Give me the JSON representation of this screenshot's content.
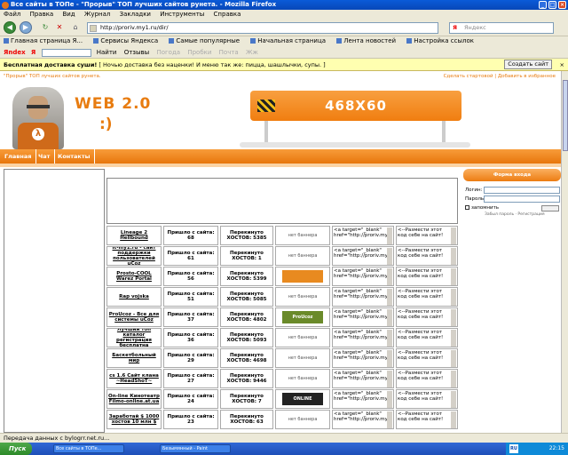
{
  "window": {
    "title": "Все сайты в ТОПе - \"Прорыв\" ТОП лучших сайтов рунета. - Mozilla Firefox"
  },
  "menu": [
    "Файл",
    "Правка",
    "Вид",
    "Журнал",
    "Закладки",
    "Инструменты",
    "Справка"
  ],
  "nav": {
    "url": "http://proriv.my1.ru/dir/",
    "search_placeholder": "Яндекс",
    "search_brand": "Я"
  },
  "bookmarks": [
    "Главная страница Я...",
    "Сервисы Яндекса",
    "Самые популярные",
    "Начальная страница",
    "Лента новостей",
    "Настройка ссылок"
  ],
  "yandex_bar": {
    "logo": "Яndex",
    "brand": "Я",
    "find": "Найти",
    "reviews": "Отзывы",
    "items": [
      "Погода",
      "Пробки",
      "Почта",
      "Жж"
    ]
  },
  "notification": {
    "bold": "Бесплатная доставка суши!",
    "text": "[ Ночью доставка без наценки! И меню так же: пицца, шашлычки, супы. ]",
    "button": "Создать сайт"
  },
  "site": {
    "top_left": "\"Прорыв\" ТОП лучших сайтов рунета.",
    "top_right": "Сделать стартовой | Добавить в избранное",
    "logo": "WEB 2.0",
    "smile": ":)",
    "banner": "468X60",
    "menu": [
      "Главная",
      "Чат",
      "Контакты"
    ]
  },
  "login": {
    "header": "Форма входа",
    "login_label": "Логин:",
    "password_label": "Пароль:",
    "remember": "запомнить",
    "small": "Забыл пароль · Регистрация"
  },
  "rows": [
    {
      "name": "Lineage 2 Hellbound",
      "visits": "Пришло с сайта: 68",
      "out": "Перекинуто ХОСТОВ: 5385",
      "button": "нет баннера",
      "code": "<a target=\"_blank\" href=\"http://proriv.my1",
      "place": "<--Размести этот код себе на сайт!"
    },
    {
      "name": "It-my1.ru - сайт поддержки пользователей uCoz",
      "visits": "Пришло с сайта: 61",
      "out": "Перекинуто ХОСТОВ: 1",
      "button": "нет баннера",
      "code": "<a target=\"_blank\" href=\"http://proriv.my1",
      "place": "<--Размести этот код себе на сайт!"
    },
    {
      "name": "Prosto-COOL Warez Portal",
      "visits": "Пришло с сайта: 56",
      "out": "Перекинуто ХОСТОВ: 5399",
      "button": "",
      "code": "<a target=\"_blank\" href=\"http://proriv.my1",
      "place": "<--Размести этот код себе на сайт!"
    },
    {
      "name": "Rap vojska",
      "visits": "Пришло с сайта: 51",
      "out": "Перекинуто ХОСТОВ: 5085",
      "button": "нет баннера",
      "code": "<a target=\"_blank\" href=\"http://proriv.my1",
      "place": "<--Размести этот код себе на сайт!"
    },
    {
      "name": "ProUcoz - Все для системы uCoz",
      "visits": "Пришло с сайта: 37",
      "out": "Перекинуто ХОСТОВ: 4802",
      "button": "ProUcoz",
      "code": "<a target=\"_blank\" href=\"http://proriv.my1",
      "place": "<--Размести этот код себе на сайт!"
    },
    {
      "name": "Лучший топ каталог регистрация бесплатна",
      "visits": "Пришло с сайта: 36",
      "out": "Перекинуто ХОСТОВ: 5093",
      "button": "нет баннера",
      "code": "<a target=\"_blank\" href=\"http://proriv.my1",
      "place": "<--Размести этот код себе на сайт!"
    },
    {
      "name": "Баскетбольный мир",
      "visits": "Пришло с сайта: 29",
      "out": "Перекинуто ХОСТОВ: 4698",
      "button": "нет баннера",
      "code": "<a target=\"_blank\" href=\"http://proriv.my1",
      "place": "<--Размести этот код себе на сайт!"
    },
    {
      "name": "cs 1.6 Сайт клана ~HeadShoT~",
      "visits": "Пришло с сайта: 27",
      "out": "Перекинуто ХОСТОВ: 9446",
      "button": "нет баннера",
      "code": "<a target=\"_blank\" href=\"http://proriv.my1",
      "place": "<--Размести этот код себе на сайт!"
    },
    {
      "name": "On-line Кинотеатр Filmo-online.at.ua",
      "visits": "Пришло с сайта: 24",
      "out": "Перекинуто ХОСТОВ: 7",
      "button": "ONLINE",
      "code": "<a target=\"_blank\" href=\"http://proriv.my1",
      "place": "<--Размести этот код себе на сайт!"
    },
    {
      "name": "Заработай $ 1000 хостов 10 млн $",
      "visits": "Пришло с сайта: 23",
      "out": "Перекинуто ХОСТОВ: 63",
      "button": "нет баннера",
      "code": "<a target=\"_blank\" href=\"http://proriv.my1",
      "place": "<--Размести этот код себе на сайт!"
    }
  ],
  "status": "Передача данных с bylogrr.net.ru...",
  "taskbar": {
    "start": "Пуск",
    "tasks": [
      "Все сайты в ТОПе...",
      "Безымянный - Paint"
    ],
    "lang": "RU",
    "time": "22:15"
  },
  "colors": {
    "accent": "#e87c10",
    "titlebar": "#0a5bd8"
  }
}
